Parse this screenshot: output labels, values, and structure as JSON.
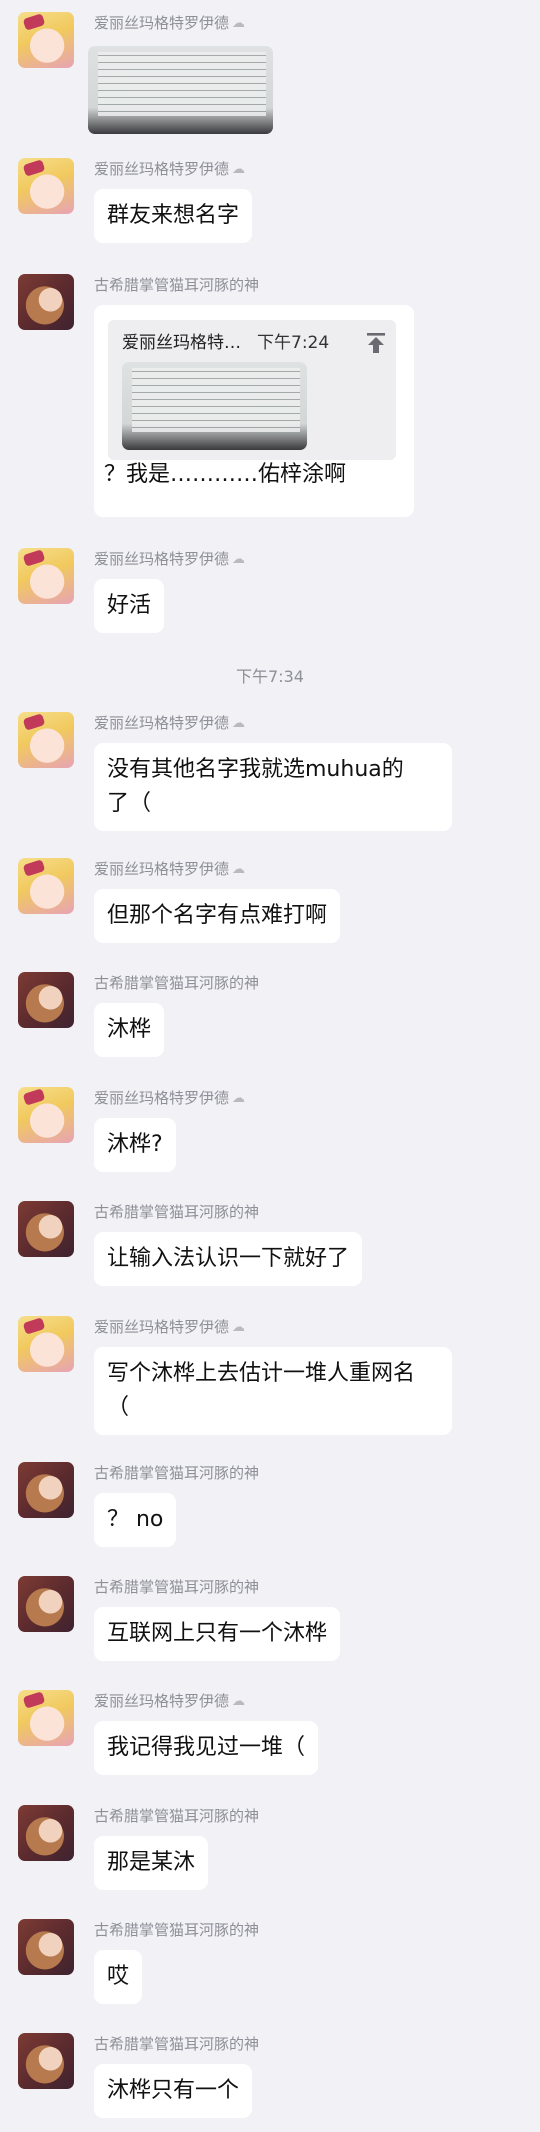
{
  "messages": [
    {
      "sender": "爱丽丝玛格特罗伊德",
      "tag": "☁",
      "type": "image"
    },
    {
      "sender": "爱丽丝玛格特罗伊德",
      "tag": "☁",
      "text": "群友来想名字"
    },
    {
      "sender": "古希腊掌管猫耳河豚的神",
      "type": "reply",
      "quote_sender": "爱丽丝玛格特…",
      "quote_time": "下午7:24",
      "text": "？我是…………佑梓涂啊"
    },
    {
      "sender": "爱丽丝玛格特罗伊德",
      "tag": "☁",
      "text": "好活"
    },
    {
      "sender": "爱丽丝玛格特罗伊德",
      "tag": "☁",
      "text": "没有其他名字我就选muhua的了（",
      "line1": "没有其他名字我就选muhua的",
      "line2": "了（"
    },
    {
      "sender": "爱丽丝玛格特罗伊德",
      "tag": "☁",
      "text": "但那个名字有点难打啊"
    },
    {
      "sender": "古希腊掌管猫耳河豚的神",
      "text": "沐桦"
    },
    {
      "sender": "爱丽丝玛格特罗伊德",
      "tag": "☁",
      "text": "沐桦?"
    },
    {
      "sender": "古希腊掌管猫耳河豚的神",
      "text": "让输入法认识一下就好了"
    },
    {
      "sender": "爱丽丝玛格特罗伊德",
      "tag": "☁",
      "text": "写个沐桦上去估计一堆人重网名（",
      "line1": "写个沐桦上去估计一堆人重网名",
      "line2": "（"
    },
    {
      "sender": "古希腊掌管猫耳河豚的神",
      "text": "？ no"
    },
    {
      "sender": "古希腊掌管猫耳河豚的神",
      "text": "互联网上只有一个沐桦"
    },
    {
      "sender": "爱丽丝玛格特罗伊德",
      "tag": "☁",
      "text": "我记得我见过一堆（"
    },
    {
      "sender": "古希腊掌管猫耳河豚的神",
      "text": "那是某沐"
    },
    {
      "sender": "古希腊掌管猫耳河豚的神",
      "text": "哎"
    },
    {
      "sender": "古希腊掌管猫耳河豚的神",
      "text": "沐桦只有一个"
    }
  ],
  "time_divider": "下午7:34",
  "icons": {
    "quote_jump": "upload-arrow-icon",
    "avatar_alice": "anime-avatar-icon",
    "avatar_dolphin": "anime-avatar-icon"
  }
}
